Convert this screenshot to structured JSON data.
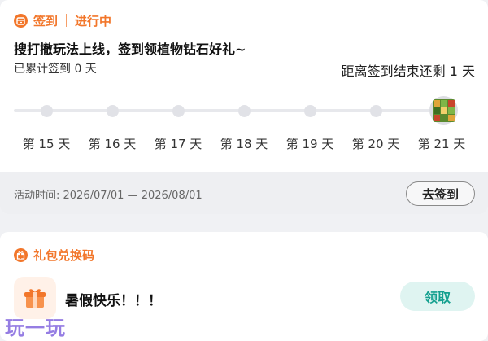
{
  "checkin": {
    "title": "签到",
    "status": "进行中",
    "headline": "搜打撤玩法上线，签到领植物钻石好礼~",
    "cumulative": "已累计签到 0 天",
    "remaining": "距离签到结束还剩 1 天",
    "days": [
      "第 15 天",
      "第 16 天",
      "第 17 天",
      "第 18 天",
      "第 19 天",
      "第 20 天",
      "第 21 天"
    ],
    "period": "活动时间: 2026/07/01 — 2026/08/01",
    "button": "去签到"
  },
  "gift": {
    "title": "礼包兑换码",
    "name": "暑假快乐！！！",
    "button": "领取"
  },
  "watermark": "玩一玩",
  "colors": {
    "accent": "#f2762a",
    "claim_text": "#14a08f",
    "claim_bg": "#dff4f1"
  },
  "icons": {
    "checkin": "calendar-icon",
    "gift_header": "gift-icon",
    "gift_item": "gift-box-icon",
    "reward": "reward-item-icon"
  }
}
